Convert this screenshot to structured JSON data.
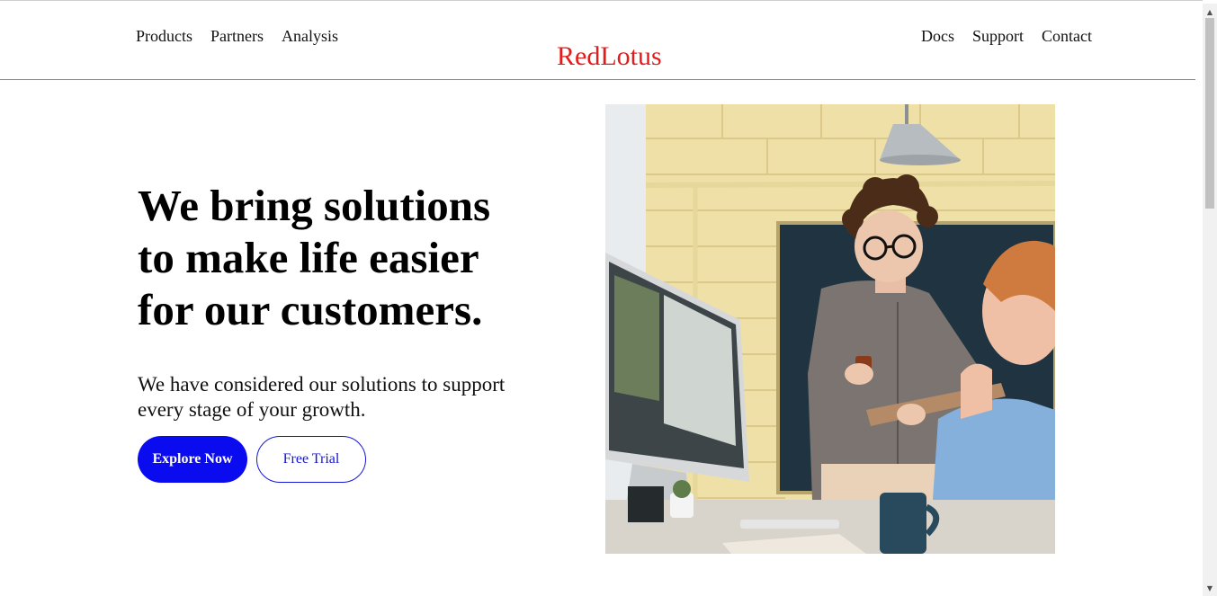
{
  "brand": "RedLotus",
  "nav_left": [
    "Products",
    "Partners",
    "Analysis"
  ],
  "nav_right": [
    "Docs",
    "Support",
    "Contact"
  ],
  "hero": {
    "title": "We bring solutions to make life easier for our customers.",
    "subtitle": "We have considered our solutions to support every stage of your growth.",
    "primary_button": "Explore Now",
    "secondary_button": "Free Trial"
  },
  "colors": {
    "brand": "#e31b1b",
    "primary_button": "#0b0bf0",
    "outline_button": "#1515d8"
  },
  "icons": {
    "scroll_up": "triangle-up-icon",
    "scroll_down": "triangle-down-icon"
  }
}
